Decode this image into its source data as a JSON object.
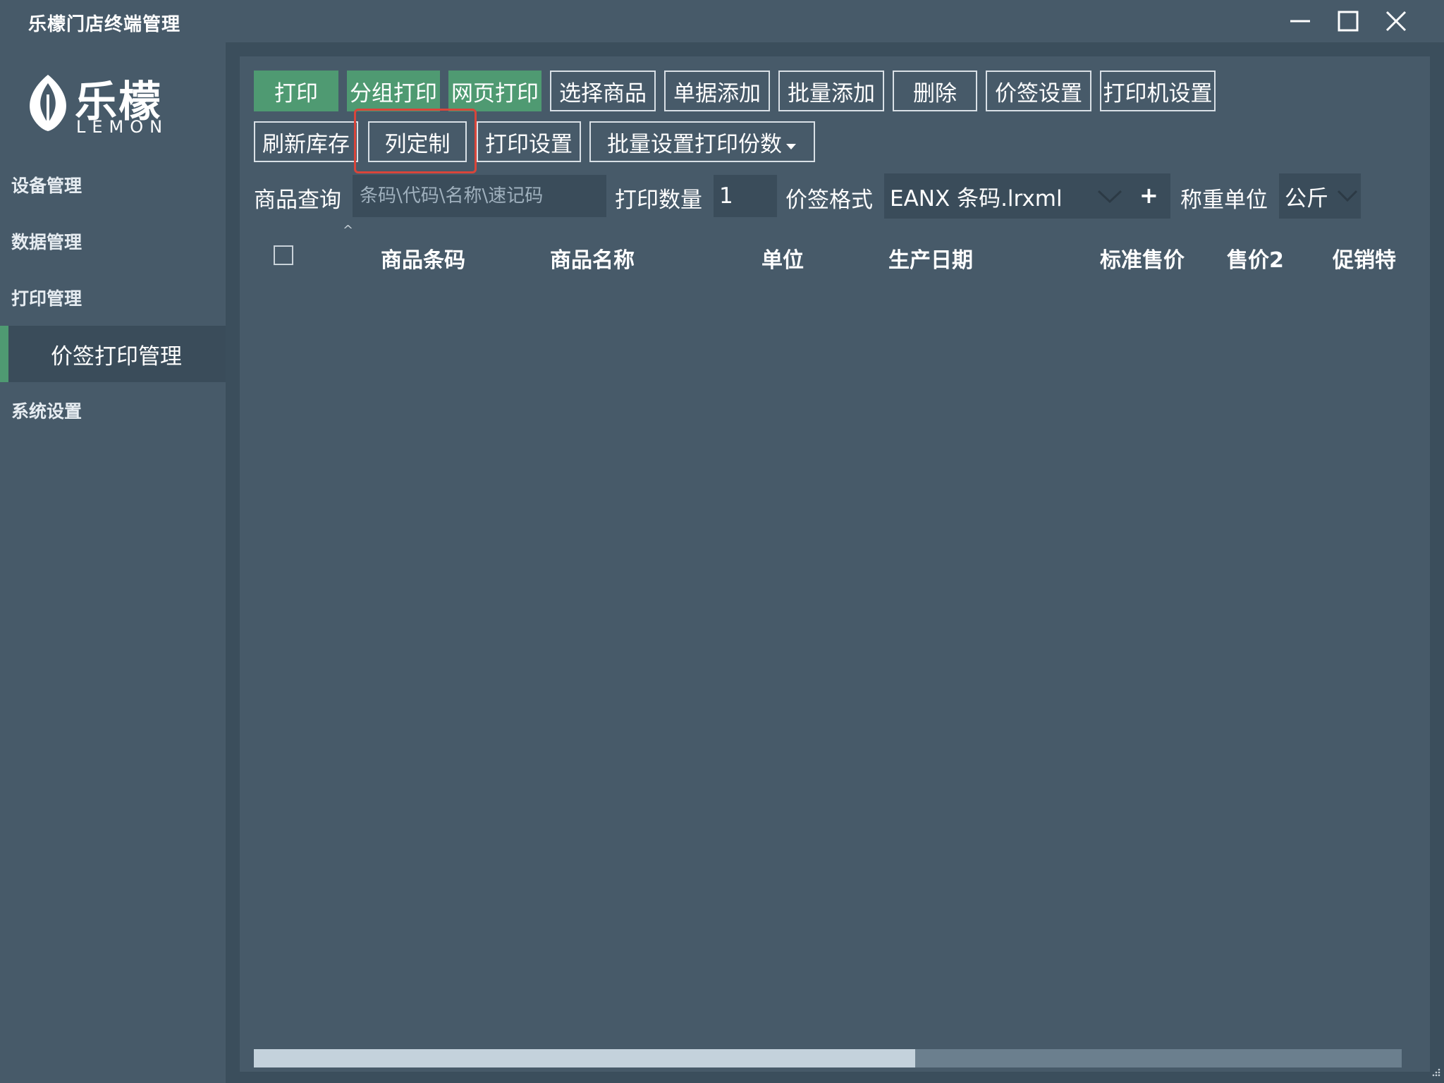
{
  "app": {
    "title": "乐檬门店终端管理"
  },
  "logo": {
    "cn": "乐檬",
    "en": "LEMON"
  },
  "sidebar": {
    "items": [
      {
        "label": "设备管理"
      },
      {
        "label": "数据管理"
      },
      {
        "label": "打印管理"
      },
      {
        "label": "价签打印管理"
      },
      {
        "label": "系统设置"
      }
    ]
  },
  "toolbar": {
    "row1": [
      {
        "label": "打印"
      },
      {
        "label": "分组打印"
      },
      {
        "label": "网页打印"
      },
      {
        "label": "选择商品"
      },
      {
        "label": "单据添加"
      },
      {
        "label": "批量添加"
      },
      {
        "label": "删除"
      },
      {
        "label": "价签设置"
      },
      {
        "label": "打印机设置"
      }
    ],
    "row2": [
      {
        "label": "刷新库存"
      },
      {
        "label": "列定制"
      },
      {
        "label": "打印设置"
      },
      {
        "label": "批量设置打印份数"
      }
    ]
  },
  "filters": {
    "search_label": "商品查询",
    "search_placeholder": "条码\\代码\\名称\\速记码",
    "qty_label": "打印数量",
    "qty_value": "1",
    "format_label": "价签格式",
    "format_value": "EANX 条码.lrxml",
    "add_symbol": "+",
    "unit_label": "称重单位",
    "unit_value": "公斤"
  },
  "table": {
    "columns": [
      "商品条码",
      "商品名称",
      "单位",
      "生产日期",
      "标准售价",
      "售价2",
      "促销特"
    ]
  },
  "colors": {
    "accent_green": "#4f9a72",
    "background": "#475a69",
    "highlight_red": "#d9453a"
  }
}
